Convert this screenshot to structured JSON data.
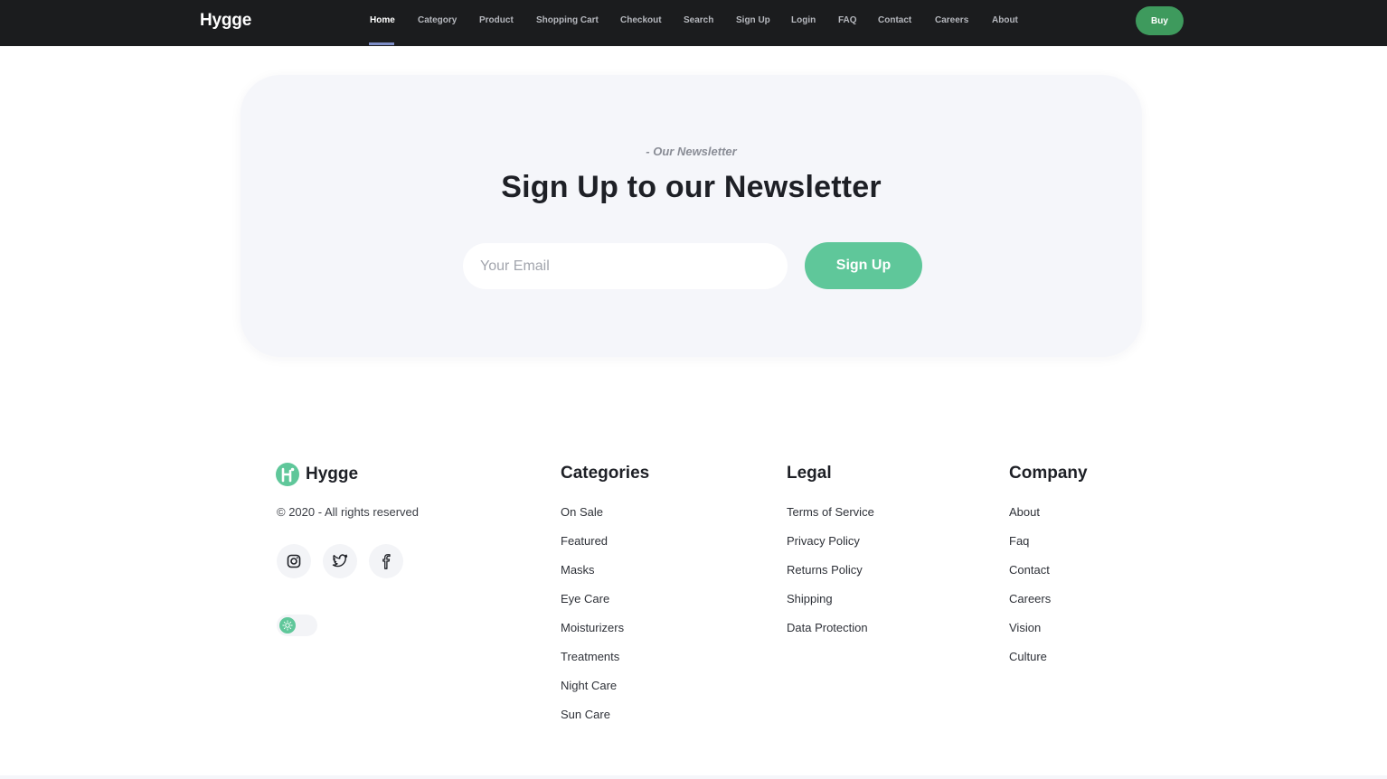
{
  "header": {
    "brand": "Hygge",
    "nav": [
      "Home",
      "Category",
      "Product",
      "Shopping Cart",
      "Checkout",
      "Search",
      "Sign Up",
      "Login",
      "FAQ",
      "Contact",
      "Careers",
      "About"
    ],
    "active_nav": "Home",
    "buy_label": "Buy"
  },
  "newsletter": {
    "eyebrow": "- Our Newsletter",
    "title": "Sign Up to our Newsletter",
    "email_placeholder": "Your Email",
    "email_value": "",
    "submit_label": "Sign Up"
  },
  "footer": {
    "brand": "Hygge",
    "copyright": "© 2020 - All rights reserved",
    "social_icons": [
      "instagram-icon",
      "twitter-icon",
      "facebook-icon"
    ],
    "theme_toggle_icon": "sun-icon",
    "columns": [
      {
        "title": "Categories",
        "links": [
          "On Sale",
          "Featured",
          "Masks",
          "Eye Care",
          "Moisturizers",
          "Treatments",
          "Night Care",
          "Sun Care"
        ]
      },
      {
        "title": "Legal",
        "links": [
          "Terms of Service",
          "Privacy Policy",
          "Returns Policy",
          "Shipping",
          "Data Protection"
        ]
      },
      {
        "title": "Company",
        "links": [
          "About",
          "Faq",
          "Contact",
          "Careers",
          "Vision",
          "Culture"
        ]
      }
    ]
  },
  "colors": {
    "topbar_bg": "#1b1c1e",
    "buy_button": "#3e9a5d",
    "accent_green": "#5fc79a",
    "card_bg": "#f5f6fa"
  }
}
